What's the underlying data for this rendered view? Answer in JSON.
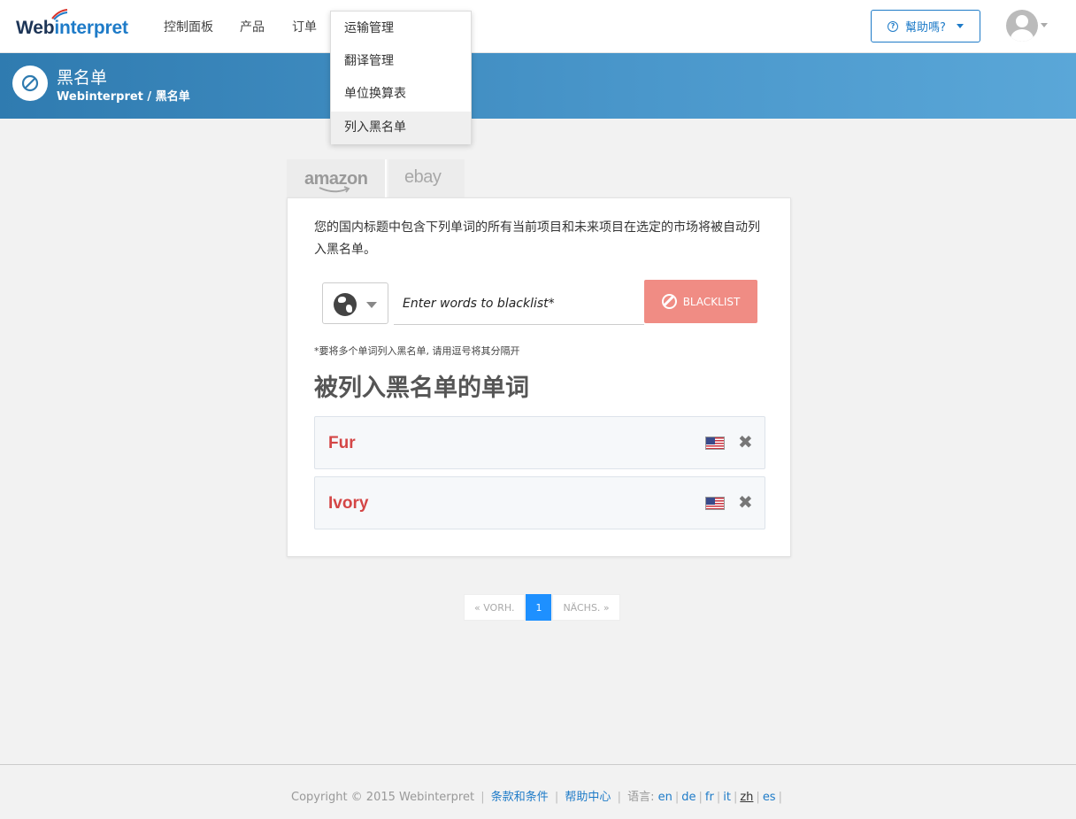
{
  "brand": {
    "logo_part1": "Web",
    "logo_part2": "interpret"
  },
  "nav": [
    {
      "label": "控制面板"
    },
    {
      "label": "产品"
    },
    {
      "label": "订单"
    }
  ],
  "help_button": {
    "label": "幫助嗎?"
  },
  "header": {
    "title": "黑名单",
    "breadcrumb": "Webinterpret / 黑名单"
  },
  "dropdown": {
    "items": [
      {
        "label": "运输管理"
      },
      {
        "label": "翻译管理"
      },
      {
        "label": "单位换算表"
      },
      {
        "label": "列入黑名单",
        "active": true
      }
    ]
  },
  "tabs": [
    {
      "label": "amazon"
    },
    {
      "label": "ebay"
    }
  ],
  "card": {
    "description": "您的国内标题中包含下列单词的所有当前项目和未来项目在选定的市场将被自动列入黑名单。",
    "input_placeholder": "Enter words to blacklist*",
    "button_label": "BLACKLIST",
    "hint": "*要将多个单词列入黑名单, 请用逗号将其分隔开",
    "section_title": "被列入黑名单的单词",
    "words": [
      {
        "word": "Fur",
        "flag": "us-flag-icon"
      },
      {
        "word": "Ivory",
        "flag": "us-flag-icon"
      }
    ]
  },
  "pagination": {
    "prev": "« VORH.",
    "current": "1",
    "next": "NÄCHS. »"
  },
  "footer": {
    "copyright": "Copyright © 2015 Webinterpret",
    "terms": "条款和条件",
    "help_center": "帮助中心",
    "language_label": "语言:",
    "languages": [
      "en",
      "de",
      "fr",
      "it",
      "zh",
      "es"
    ],
    "current_language": "zh"
  },
  "colors": {
    "accent": "#1e7bc8",
    "banner": "#4a97cb",
    "blacklist_button": "#f08c84",
    "word_text": "#d44646"
  }
}
